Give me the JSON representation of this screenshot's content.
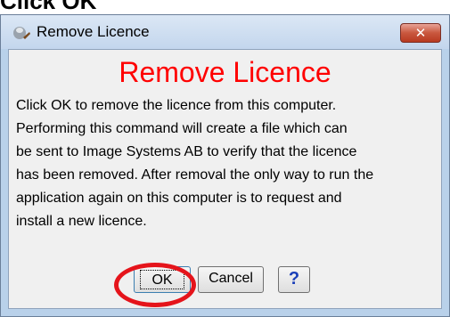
{
  "caption": "Click OK",
  "window": {
    "title": "Remove Licence",
    "close_label": "✕"
  },
  "dialog": {
    "heading": "Remove Licence",
    "lines": [
      "Click OK to remove the licence from this computer.",
      "Performing this command will create a file which can",
      "be sent to Image Systems AB to verify that the licence",
      "has been removed. After removal the only way to run the",
      "application again on this computer is to request and",
      "install a new licence."
    ],
    "ok_label": "OK",
    "cancel_label": "Cancel",
    "help_label": "?"
  },
  "colors": {
    "heading": "#ff0000",
    "highlight": "#e5141b",
    "close_button": "#c9573e"
  }
}
